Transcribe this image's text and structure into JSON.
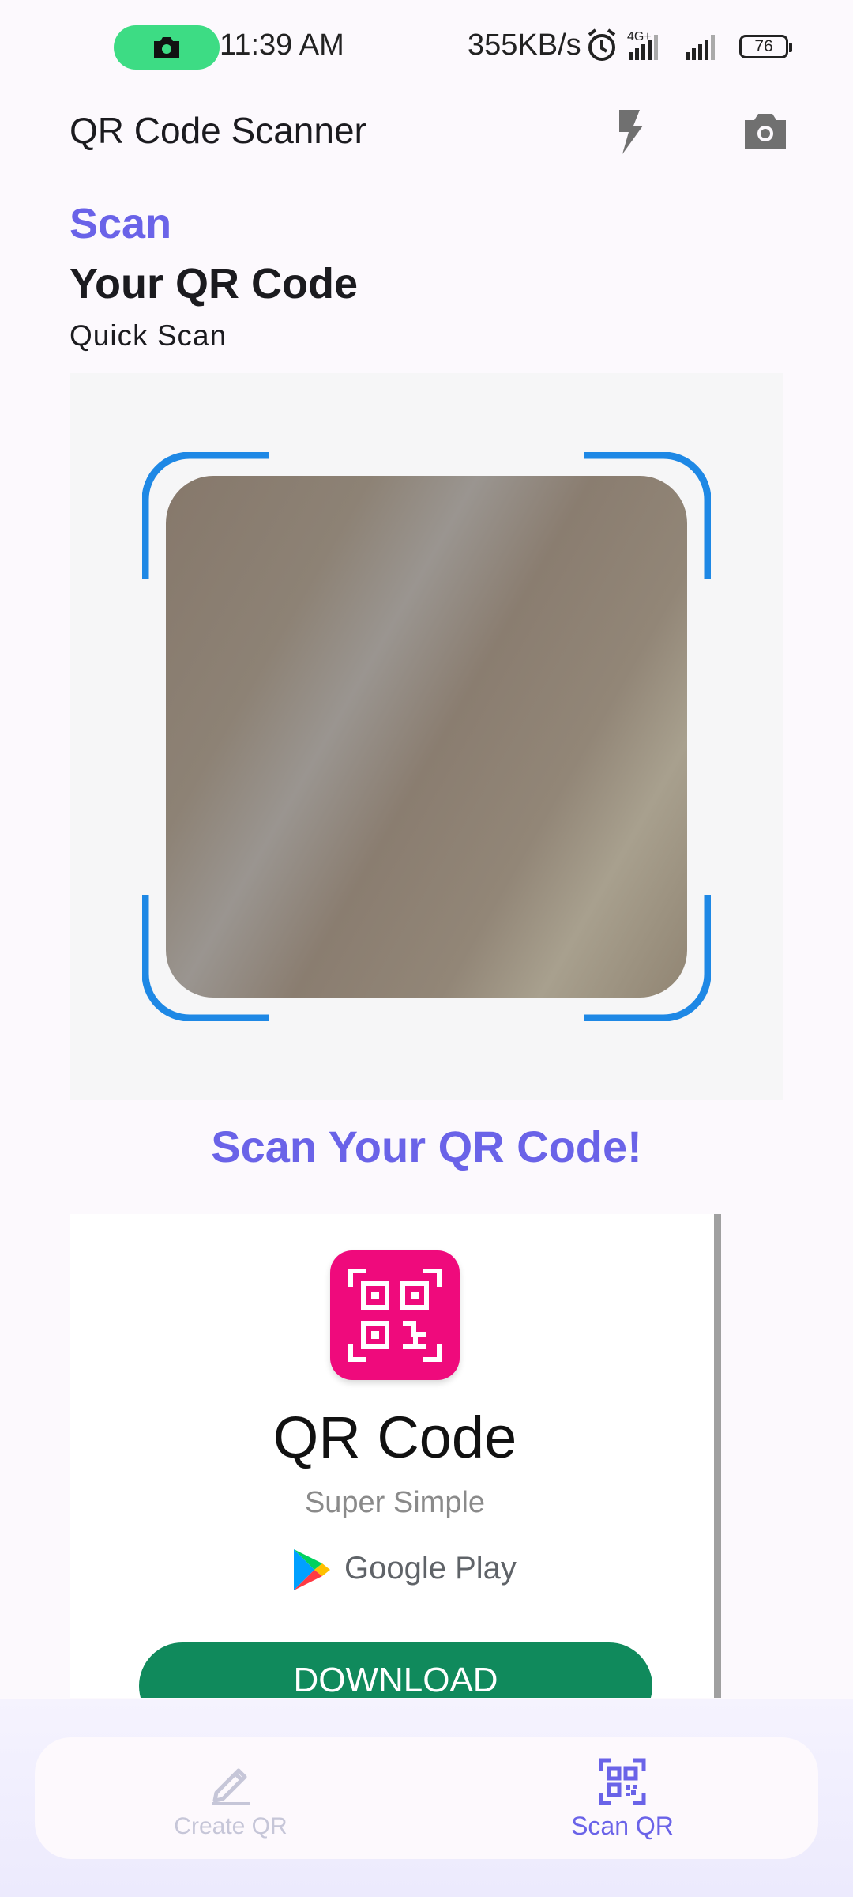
{
  "status_bar": {
    "time": "11:39 AM",
    "network_speed": "355KB/s",
    "network_type": "4G+",
    "battery_level": "76",
    "icons": [
      "camera-icon",
      "alarm-icon",
      "signal-icon",
      "battery-icon"
    ]
  },
  "app_bar": {
    "title": "QR Code Scanner",
    "actions": [
      {
        "name": "flash",
        "icon": "flash-icon"
      },
      {
        "name": "switch-camera",
        "icon": "camera-icon"
      }
    ]
  },
  "header": {
    "accent": "Scan",
    "title": "Your QR Code",
    "subtitle": "Quick Scan"
  },
  "scanner": {
    "cta": "Scan Your QR Code!"
  },
  "ad": {
    "title": "QR Code",
    "tagline": "Super Simple",
    "store": "Google Play",
    "button": "DOWNLOAD"
  },
  "bottom_nav": {
    "items": [
      {
        "label": "Create QR",
        "icon": "pencil-icon",
        "active": false
      },
      {
        "label": "Scan QR",
        "icon": "qr-scan-icon",
        "active": true
      }
    ]
  },
  "colors": {
    "accent": "#6a63e8",
    "frame": "#1e88e5",
    "ad_icon": "#ef0a7c",
    "download": "#108a5c",
    "camera_pill": "#3ddc84"
  }
}
